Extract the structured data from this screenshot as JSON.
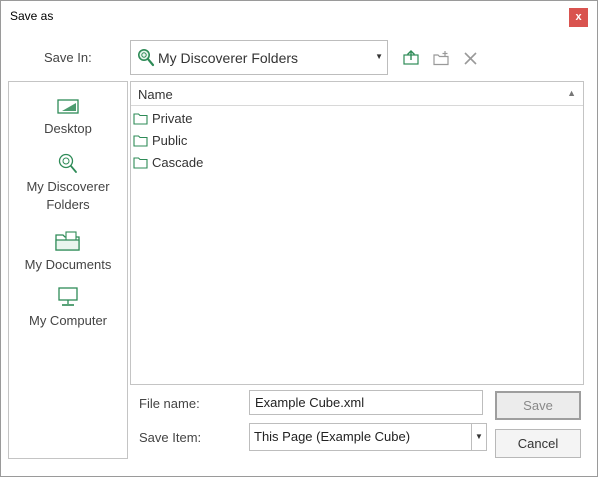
{
  "window": {
    "title": "Save as",
    "close_label": "x"
  },
  "save_in": {
    "label": "Save In:",
    "value": "My Discoverer Folders",
    "icon": "search-icon"
  },
  "toolbar": {
    "icons": [
      "up-folder-icon",
      "new-folder-icon",
      "delete-icon"
    ]
  },
  "places": [
    {
      "label": "Desktop",
      "icon": "desktop-icon"
    },
    {
      "label": "My Discoverer Folders",
      "icon": "search-icon"
    },
    {
      "label": "My Documents",
      "icon": "documents-icon"
    },
    {
      "label": "My Computer",
      "icon": "computer-icon"
    }
  ],
  "file_list": {
    "column_header": "Name",
    "items": [
      {
        "name": "Private",
        "icon": "folder-icon"
      },
      {
        "name": "Public",
        "icon": "folder-icon"
      },
      {
        "name": "Cascade",
        "icon": "folder-icon"
      }
    ]
  },
  "form": {
    "file_name_label": "File name:",
    "file_name_value": "Example Cube.xml",
    "save_item_label": "Save Item:",
    "save_item_value": "This Page (Example Cube)"
  },
  "buttons": {
    "save": "Save",
    "cancel": "Cancel"
  },
  "colors": {
    "accent": "#2e8b57",
    "close": "#d9534f"
  }
}
